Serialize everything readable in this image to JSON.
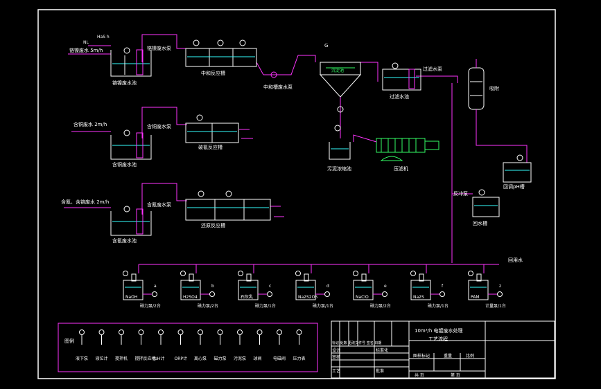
{
  "colors": {
    "background": "#000000",
    "frame": "#ffffff",
    "pipe": "#ff33ff",
    "equipment": "#ffffff",
    "water": "#33ffff",
    "label": "#33ff66",
    "flow_arrow": "#ff3333"
  },
  "header_labels": {
    "top_flow": "HaS h",
    "top_rate": "3m/h",
    "nl": "NL",
    "inlet_chrome": "铬镍废水 5m/h",
    "inlet_copper": "含铜废水 2m/h",
    "inlet_cyanide": "含氰、含铬废水 2m/h"
  },
  "tanks": {
    "chrome_pump": "铬镍废水泵",
    "chrome_pool": "铬镍废水池",
    "neutral_tank": "中和反应槽",
    "neutral_pump": "中和槽废水泵",
    "settler": "G",
    "settler_text": "沉淀池",
    "filter_pump": "过滤水泵",
    "filter_tank": "过滤水池",
    "copper_pump": "含铜废水泵",
    "copper_pool": "含铜废水池",
    "break_tank": "破氰反应槽",
    "sludge_tank": "污泥浓缩池",
    "press": "压滤机",
    "cyanide_pump": "含氰废水泵",
    "cyanide_pool": "含氰废水池",
    "redox_tank": "还原反应槽",
    "adsorb": "吸附",
    "ph_tank": "回调pH槽",
    "back_pump": "反冲泵",
    "return_pool": "回水槽",
    "ion_label": "离子交换器",
    "reuse_label": "回用水"
  },
  "dosing": [
    {
      "chem": "NaOH",
      "tag": "a"
    },
    {
      "chem": "H2SO4",
      "tag": "b"
    },
    {
      "chem": "石灰乳",
      "tag": "c"
    },
    {
      "chem": "Na2S2O5",
      "tag": "d"
    },
    {
      "chem": "NaClO",
      "tag": "e"
    },
    {
      "chem": "Na2S",
      "tag": "f"
    },
    {
      "chem": "PAM",
      "tag": "z"
    }
  ],
  "pump_labels": [
    "磁力泵/2台",
    "磁力泵/2台",
    "磁力泵/1台",
    "磁力泵/1台",
    "磁力泵/2台",
    "磁力泵/1台",
    "计量泵/1台"
  ],
  "legend": {
    "title": "图例",
    "items": [
      "液下泵",
      "液位计",
      "搅拌机",
      "搅拌反应槽",
      "pH计",
      "ORP计",
      "离心泵",
      "磁力泵",
      "污泥泵",
      "球阀",
      "电磁阀",
      "压力表"
    ]
  },
  "title_block": {
    "title1": "10m³/h 电镀废水处理",
    "title2": "工艺流程",
    "row_header": "标记 处数 更改文件号 签名 日期",
    "designer": "设计",
    "standard": "标准化",
    "review": "审核",
    "craft": "工艺",
    "approve": "批准",
    "stage": "图样标记",
    "weight": "重量",
    "scale": "比例",
    "sheets": "共 页",
    "sheet": "第 页"
  }
}
